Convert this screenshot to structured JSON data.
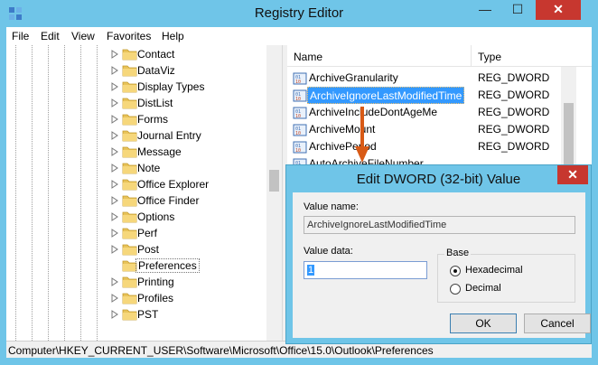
{
  "window": {
    "title": "Registry Editor",
    "minimize": "—",
    "maximize": "☐",
    "close": "✕"
  },
  "menu": [
    "File",
    "Edit",
    "View",
    "Favorites",
    "Help"
  ],
  "tree": {
    "items": [
      {
        "label": "Contact"
      },
      {
        "label": "DataViz"
      },
      {
        "label": "Display Types"
      },
      {
        "label": "DistList"
      },
      {
        "label": "Forms"
      },
      {
        "label": "Journal Entry"
      },
      {
        "label": "Message"
      },
      {
        "label": "Note"
      },
      {
        "label": "Office Explorer"
      },
      {
        "label": "Office Finder"
      },
      {
        "label": "Options"
      },
      {
        "label": "Perf"
      },
      {
        "label": "Post"
      },
      {
        "label": "Preferences",
        "selected": true
      },
      {
        "label": "Printing"
      },
      {
        "label": "Profiles"
      },
      {
        "label": "PST"
      }
    ]
  },
  "list": {
    "columns": {
      "name": "Name",
      "type": "Type"
    },
    "rows": [
      {
        "name": "ArchiveGranularity",
        "type": "REG_DWORD"
      },
      {
        "name": "ArchiveIgnoreLastModifiedTime",
        "type": "REG_DWORD",
        "selected": true
      },
      {
        "name": "ArchiveIncludeDontAgeMe",
        "type": "REG_DWORD"
      },
      {
        "name": "ArchiveMount",
        "type": "REG_DWORD"
      },
      {
        "name": "ArchivePeriod",
        "type": "REG_DWORD"
      },
      {
        "name": "AutoArchiveFileNumber",
        "type": ""
      }
    ]
  },
  "status": {
    "path": "Computer\\HKEY_CURRENT_USER\\Software\\Microsoft\\Office\\15.0\\Outlook\\Preferences"
  },
  "dialog": {
    "title": "Edit DWORD (32-bit) Value",
    "close": "✕",
    "value_name_label": "Value name:",
    "value_name": "ArchiveIgnoreLastModifiedTime",
    "value_data_label": "Value data:",
    "value_data": "1",
    "base_label": "Base",
    "hex_label": "Hexadecimal",
    "dec_label": "Decimal",
    "selected_base": "Hexadecimal",
    "ok_label": "OK",
    "cancel_label": "Cancel"
  },
  "colors": {
    "frame": "#6fc5e8",
    "selection": "#3399ff",
    "close": "#c7372f",
    "arrow": "#d85a16"
  }
}
